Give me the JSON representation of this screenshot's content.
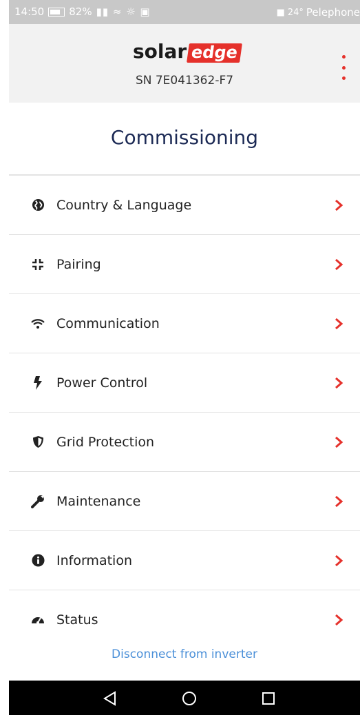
{
  "status_bar": {
    "time": "14:50",
    "battery": "82%",
    "temperature": "24°",
    "carrier": "Pelephone"
  },
  "header": {
    "logo_solar": "solar",
    "logo_edge": "edge",
    "serial": "SN 7E041362-F7"
  },
  "page": {
    "title": "Commissioning"
  },
  "menu": {
    "items": [
      {
        "label": "Country & Language",
        "icon": "globe-icon"
      },
      {
        "label": "Pairing",
        "icon": "pairing-icon"
      },
      {
        "label": "Communication",
        "icon": "wifi-icon"
      },
      {
        "label": "Power Control",
        "icon": "bolt-icon"
      },
      {
        "label": "Grid Protection",
        "icon": "shield-icon"
      },
      {
        "label": "Maintenance",
        "icon": "wrench-icon"
      },
      {
        "label": "Information",
        "icon": "info-icon"
      },
      {
        "label": "Status",
        "icon": "gauge-icon"
      }
    ]
  },
  "footer": {
    "disconnect_label": "Disconnect from inverter"
  },
  "colors": {
    "accent": "#e5312b",
    "title": "#1c2a55",
    "link": "#4a8fd8"
  }
}
